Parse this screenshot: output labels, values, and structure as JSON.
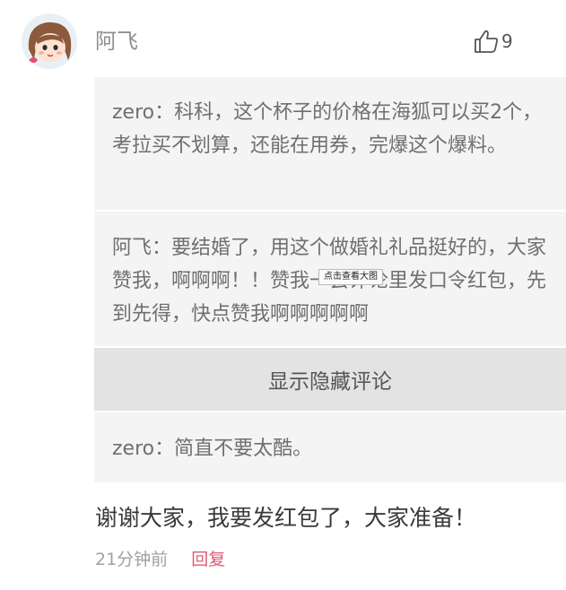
{
  "comment": {
    "username": "阿飞",
    "avatar_icon": "cartoon-girl-avatar",
    "like_icon": "thumbs-up-icon",
    "like_count": "9",
    "text": "谢谢大家，我要发红包了，大家准备！",
    "timestamp": "21分钟前",
    "reply_label": "回复"
  },
  "quoted_replies": [
    {
      "text": "zero：科科，这个杯子的价格在海狐可以买2个，考拉买不划算，还能在用券，完爆这个爆料。"
    },
    {
      "text": "阿飞：要结婚了，用这个做婚礼礼品挺好的，大家赞我，啊啊啊！！赞我一会评论里发口令红包，先到先得，快点赞我啊啊啊啊啊"
    },
    {
      "text": "zero：简直不要太酷。"
    }
  ],
  "expand_label": "显示隐藏评论",
  "tooltip": "点击查看大图",
  "colors": {
    "accent_reply": "#e05a7a",
    "quote_bg": "#f4f4f4",
    "expand_bg": "#e3e3e3"
  }
}
